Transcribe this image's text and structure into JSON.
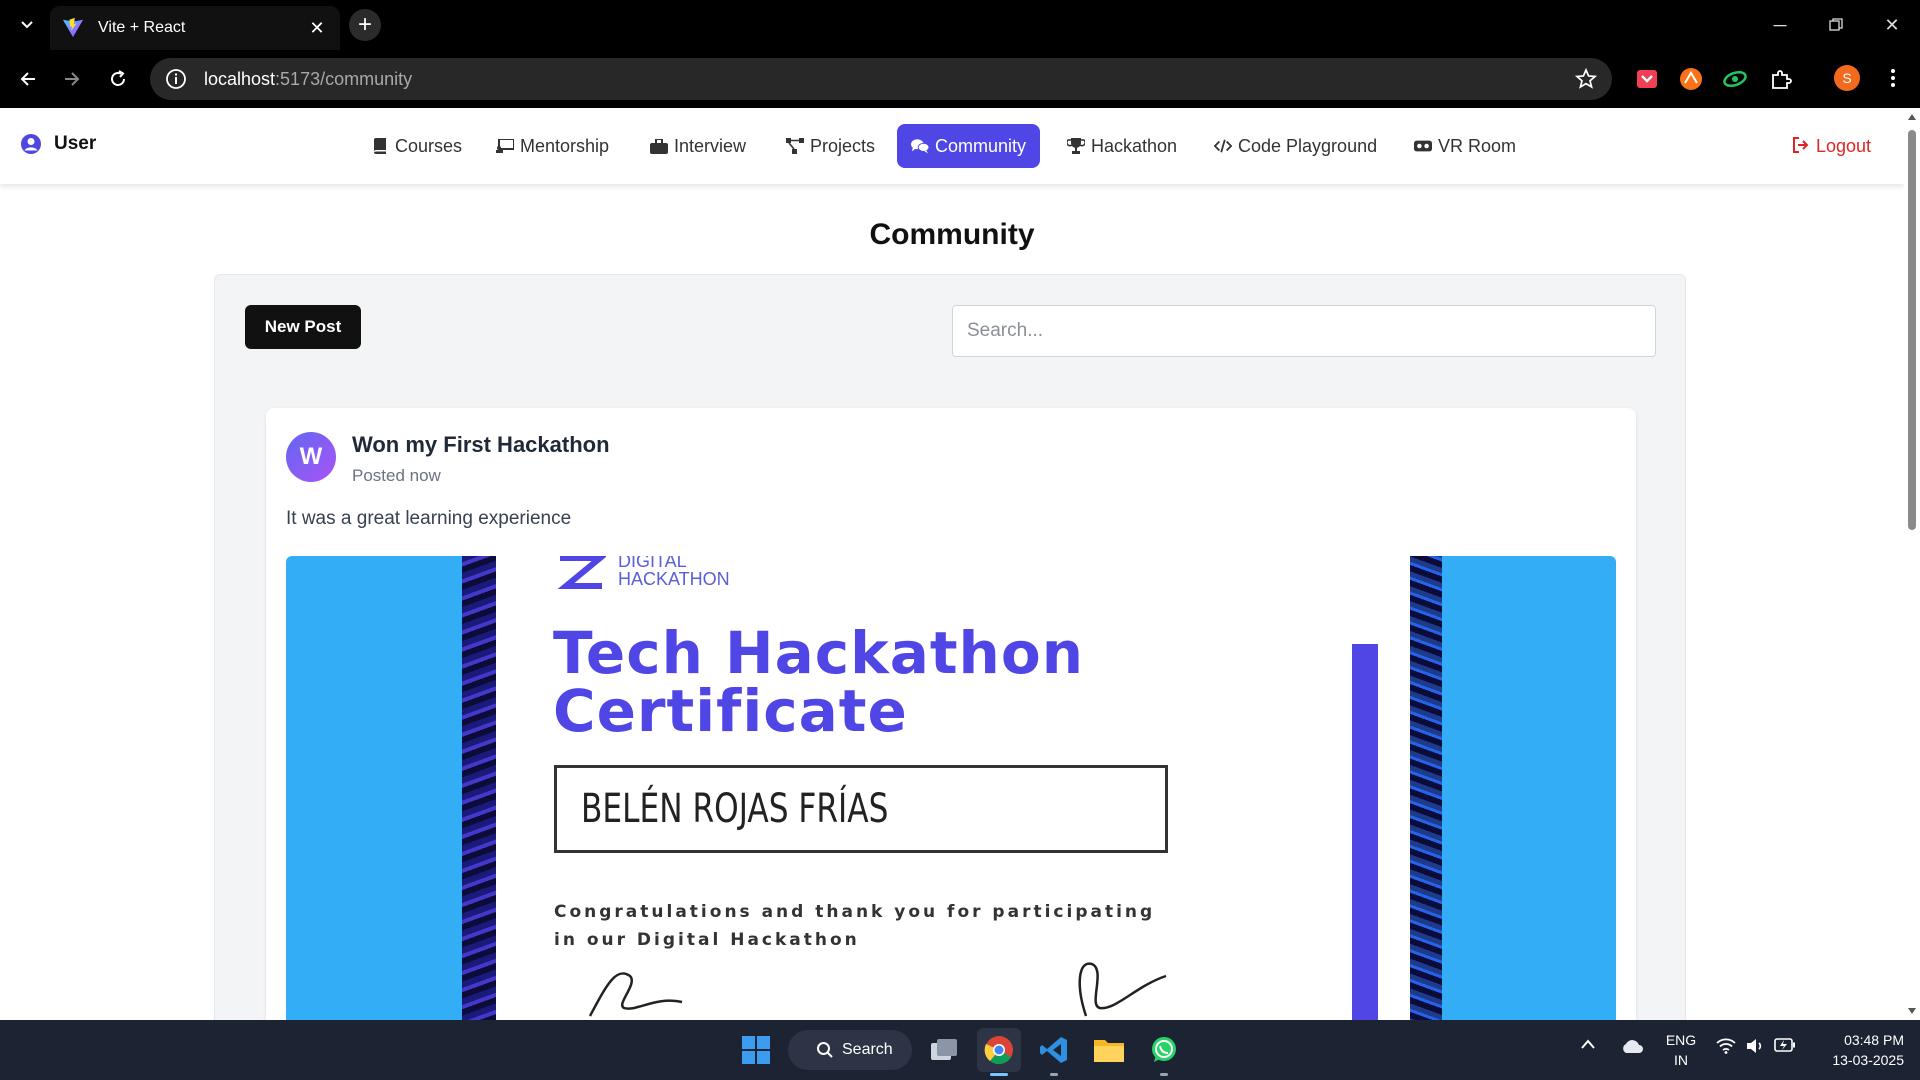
{
  "browser": {
    "tab_title": "Vite + React",
    "url_host": "localhost",
    "url_path": ":5173/community",
    "profile_initial": "S"
  },
  "nav": {
    "user_label": "User",
    "items": [
      {
        "label": "Courses",
        "icon": "book-icon"
      },
      {
        "label": "Mentorship",
        "icon": "chalkboard-icon"
      },
      {
        "label": "Interview",
        "icon": "briefcase-icon"
      },
      {
        "label": "Projects",
        "icon": "diagram-icon"
      },
      {
        "label": "Community",
        "icon": "comments-icon",
        "active": true
      },
      {
        "label": "Hackathon",
        "icon": "trophy-icon"
      },
      {
        "label": "Code Playground",
        "icon": "code-icon"
      },
      {
        "label": "VR Room",
        "icon": "vr-headset-icon"
      }
    ],
    "logout_label": "Logout",
    "accent_color": "#4f46e5",
    "logout_color": "#dc2626"
  },
  "page": {
    "title": "Community",
    "new_post_label": "New Post",
    "search_placeholder": "Search..."
  },
  "posts": [
    {
      "avatar_initial": "W",
      "title": "Won my First Hackathon",
      "time": "Posted now",
      "body": "It was a great learning experience",
      "certificate": {
        "logo_line1": "DIGITAL",
        "logo_line2": "HACKATHON",
        "heading_line1": "Tech Hackathon",
        "heading_line2": "Certificate",
        "recipient": "BELÉN ROJAS FRÍAS",
        "message_line1": "Congratulations and thank you for participating",
        "message_line2": "in our Digital Hackathon"
      }
    }
  ],
  "taskbar": {
    "search_label": "Search",
    "lang_line1": "ENG",
    "lang_line2": "IN",
    "time": "03:48 PM",
    "date": "13-03-2025"
  }
}
